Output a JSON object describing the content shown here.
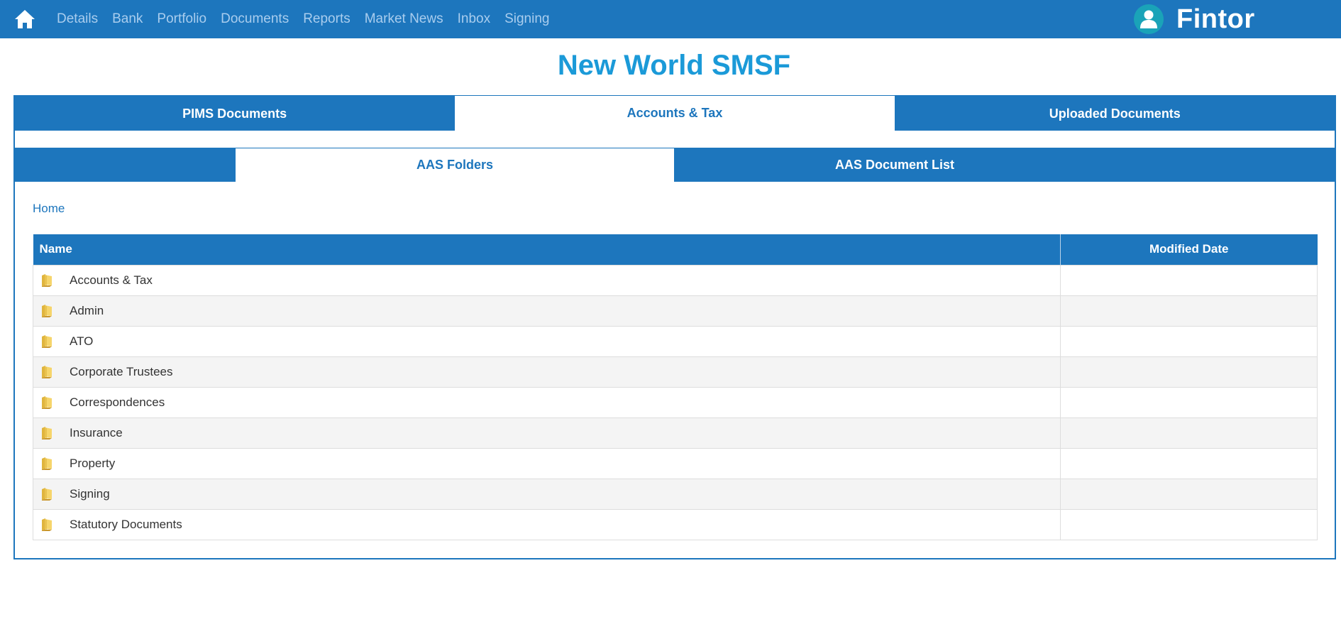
{
  "nav": {
    "items": [
      "Details",
      "Bank",
      "Portfolio",
      "Documents",
      "Reports",
      "Market News",
      "Inbox",
      "Signing"
    ],
    "brand": "Fintor"
  },
  "page": {
    "title": "New World SMSF"
  },
  "main_tabs": [
    "PIMS Documents",
    "Accounts & Tax",
    "Uploaded Documents"
  ],
  "main_tab_active": "Accounts & Tax",
  "sub_tabs": [
    "AAS Folders",
    "AAS Document List"
  ],
  "sub_tab_active": "AAS Folders",
  "breadcrumb": "Home",
  "table": {
    "headers": [
      "Name",
      "Modified Date"
    ],
    "rows": [
      {
        "name": "Accounts & Tax",
        "modified": ""
      },
      {
        "name": "Admin",
        "modified": ""
      },
      {
        "name": "ATO",
        "modified": ""
      },
      {
        "name": "Corporate Trustees",
        "modified": ""
      },
      {
        "name": "Correspondences",
        "modified": ""
      },
      {
        "name": "Insurance",
        "modified": ""
      },
      {
        "name": "Property",
        "modified": ""
      },
      {
        "name": "Signing",
        "modified": ""
      },
      {
        "name": "Statutory Documents",
        "modified": ""
      }
    ]
  },
  "icons": {
    "home": "home-icon",
    "avatar": "user-icon",
    "folder": "folder-icon"
  },
  "colors": {
    "primary": "#1d76bd",
    "title": "#1b9ad8",
    "nav_text": "#a9cdee",
    "avatar_bg": "#1aa3b8"
  }
}
